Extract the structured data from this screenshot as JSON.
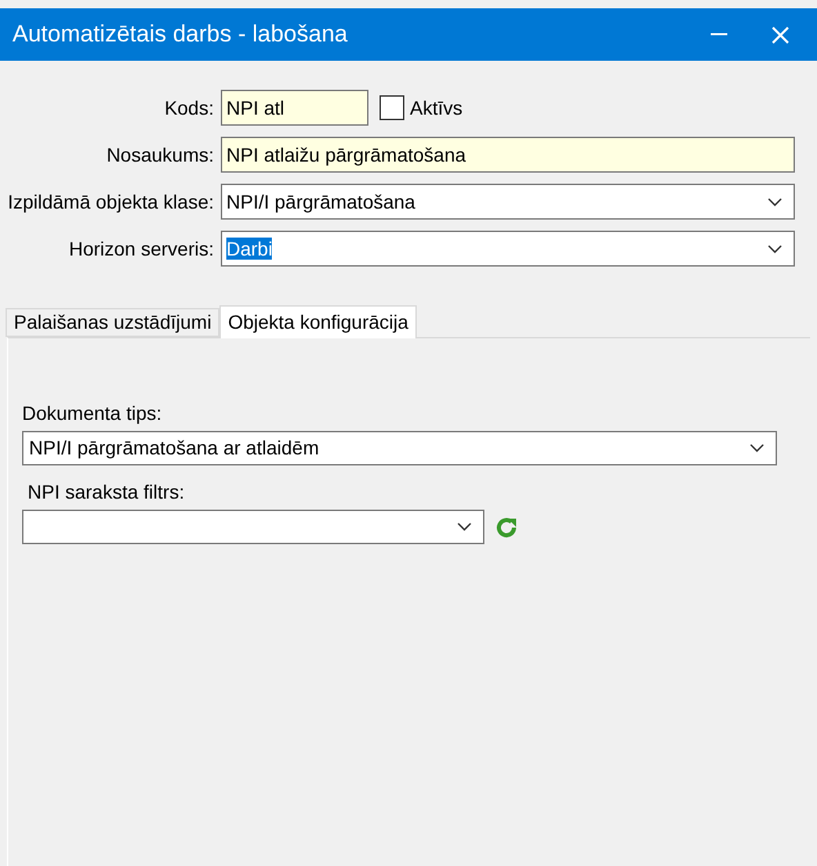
{
  "window": {
    "title": "Automatizētais darbs - labošana"
  },
  "form": {
    "code": {
      "label": "Kods:",
      "value": "NPI atl"
    },
    "active": {
      "label": "Aktīvs",
      "checked": false
    },
    "fields": [
      {
        "kind": "text",
        "label": "Nosaukums:",
        "value": "NPI atlaižu pārgrāmatošana",
        "highlighted": false
      },
      {
        "kind": "dropdown",
        "label": "Izpildāmā objekta klase:",
        "value": "NPI/I pārgrāmatošana",
        "highlighted": false
      },
      {
        "kind": "dropdown",
        "label": "Horizon serveris:",
        "value": "Darbi",
        "highlighted": true
      }
    ]
  },
  "tabs": [
    {
      "label": "Palaišanas uzstādījumi",
      "selected": false
    },
    {
      "label": "Objekta konfigurācija",
      "selected": true
    }
  ],
  "tab_content": {
    "document_type": {
      "label": "Dokumenta tips:",
      "value": "NPI/I pārgrāmatošana ar atlaidēm"
    },
    "filter": {
      "label": "NPI saraksta filtrs:"
    }
  }
}
